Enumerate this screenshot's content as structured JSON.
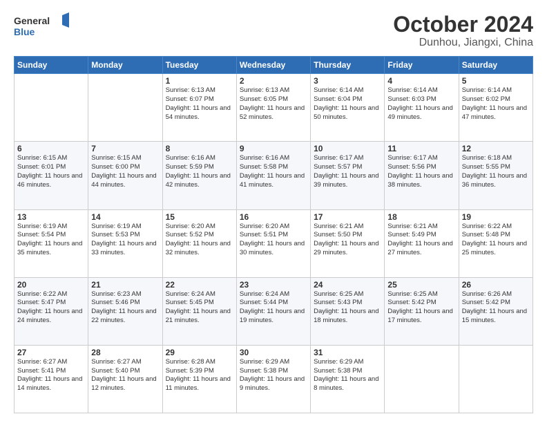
{
  "header": {
    "logo_line1": "General",
    "logo_line2": "Blue",
    "title": "October 2024",
    "subtitle": "Dunhou, Jiangxi, China"
  },
  "weekdays": [
    "Sunday",
    "Monday",
    "Tuesday",
    "Wednesday",
    "Thursday",
    "Friday",
    "Saturday"
  ],
  "weeks": [
    [
      {
        "day": "",
        "info": ""
      },
      {
        "day": "",
        "info": ""
      },
      {
        "day": "1",
        "info": "Sunrise: 6:13 AM\nSunset: 6:07 PM\nDaylight: 11 hours and 54 minutes."
      },
      {
        "day": "2",
        "info": "Sunrise: 6:13 AM\nSunset: 6:05 PM\nDaylight: 11 hours and 52 minutes."
      },
      {
        "day": "3",
        "info": "Sunrise: 6:14 AM\nSunset: 6:04 PM\nDaylight: 11 hours and 50 minutes."
      },
      {
        "day": "4",
        "info": "Sunrise: 6:14 AM\nSunset: 6:03 PM\nDaylight: 11 hours and 49 minutes."
      },
      {
        "day": "5",
        "info": "Sunrise: 6:14 AM\nSunset: 6:02 PM\nDaylight: 11 hours and 47 minutes."
      }
    ],
    [
      {
        "day": "6",
        "info": "Sunrise: 6:15 AM\nSunset: 6:01 PM\nDaylight: 11 hours and 46 minutes."
      },
      {
        "day": "7",
        "info": "Sunrise: 6:15 AM\nSunset: 6:00 PM\nDaylight: 11 hours and 44 minutes."
      },
      {
        "day": "8",
        "info": "Sunrise: 6:16 AM\nSunset: 5:59 PM\nDaylight: 11 hours and 42 minutes."
      },
      {
        "day": "9",
        "info": "Sunrise: 6:16 AM\nSunset: 5:58 PM\nDaylight: 11 hours and 41 minutes."
      },
      {
        "day": "10",
        "info": "Sunrise: 6:17 AM\nSunset: 5:57 PM\nDaylight: 11 hours and 39 minutes."
      },
      {
        "day": "11",
        "info": "Sunrise: 6:17 AM\nSunset: 5:56 PM\nDaylight: 11 hours and 38 minutes."
      },
      {
        "day": "12",
        "info": "Sunrise: 6:18 AM\nSunset: 5:55 PM\nDaylight: 11 hours and 36 minutes."
      }
    ],
    [
      {
        "day": "13",
        "info": "Sunrise: 6:19 AM\nSunset: 5:54 PM\nDaylight: 11 hours and 35 minutes."
      },
      {
        "day": "14",
        "info": "Sunrise: 6:19 AM\nSunset: 5:53 PM\nDaylight: 11 hours and 33 minutes."
      },
      {
        "day": "15",
        "info": "Sunrise: 6:20 AM\nSunset: 5:52 PM\nDaylight: 11 hours and 32 minutes."
      },
      {
        "day": "16",
        "info": "Sunrise: 6:20 AM\nSunset: 5:51 PM\nDaylight: 11 hours and 30 minutes."
      },
      {
        "day": "17",
        "info": "Sunrise: 6:21 AM\nSunset: 5:50 PM\nDaylight: 11 hours and 29 minutes."
      },
      {
        "day": "18",
        "info": "Sunrise: 6:21 AM\nSunset: 5:49 PM\nDaylight: 11 hours and 27 minutes."
      },
      {
        "day": "19",
        "info": "Sunrise: 6:22 AM\nSunset: 5:48 PM\nDaylight: 11 hours and 25 minutes."
      }
    ],
    [
      {
        "day": "20",
        "info": "Sunrise: 6:22 AM\nSunset: 5:47 PM\nDaylight: 11 hours and 24 minutes."
      },
      {
        "day": "21",
        "info": "Sunrise: 6:23 AM\nSunset: 5:46 PM\nDaylight: 11 hours and 22 minutes."
      },
      {
        "day": "22",
        "info": "Sunrise: 6:24 AM\nSunset: 5:45 PM\nDaylight: 11 hours and 21 minutes."
      },
      {
        "day": "23",
        "info": "Sunrise: 6:24 AM\nSunset: 5:44 PM\nDaylight: 11 hours and 19 minutes."
      },
      {
        "day": "24",
        "info": "Sunrise: 6:25 AM\nSunset: 5:43 PM\nDaylight: 11 hours and 18 minutes."
      },
      {
        "day": "25",
        "info": "Sunrise: 6:25 AM\nSunset: 5:42 PM\nDaylight: 11 hours and 17 minutes."
      },
      {
        "day": "26",
        "info": "Sunrise: 6:26 AM\nSunset: 5:42 PM\nDaylight: 11 hours and 15 minutes."
      }
    ],
    [
      {
        "day": "27",
        "info": "Sunrise: 6:27 AM\nSunset: 5:41 PM\nDaylight: 11 hours and 14 minutes."
      },
      {
        "day": "28",
        "info": "Sunrise: 6:27 AM\nSunset: 5:40 PM\nDaylight: 11 hours and 12 minutes."
      },
      {
        "day": "29",
        "info": "Sunrise: 6:28 AM\nSunset: 5:39 PM\nDaylight: 11 hours and 11 minutes."
      },
      {
        "day": "30",
        "info": "Sunrise: 6:29 AM\nSunset: 5:38 PM\nDaylight: 11 hours and 9 minutes."
      },
      {
        "day": "31",
        "info": "Sunrise: 6:29 AM\nSunset: 5:38 PM\nDaylight: 11 hours and 8 minutes."
      },
      {
        "day": "",
        "info": ""
      },
      {
        "day": "",
        "info": ""
      }
    ]
  ]
}
